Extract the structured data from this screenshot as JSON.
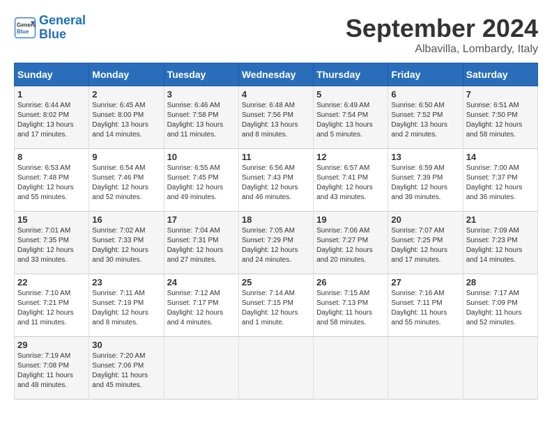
{
  "header": {
    "logo_line1": "General",
    "logo_line2": "Blue",
    "month_year": "September 2024",
    "location": "Albavilla, Lombardy, Italy"
  },
  "columns": [
    "Sunday",
    "Monday",
    "Tuesday",
    "Wednesday",
    "Thursday",
    "Friday",
    "Saturday"
  ],
  "weeks": [
    [
      {
        "day": "1",
        "info": "Sunrise: 6:44 AM\nSunset: 8:02 PM\nDaylight: 13 hours\nand 17 minutes."
      },
      {
        "day": "2",
        "info": "Sunrise: 6:45 AM\nSunset: 8:00 PM\nDaylight: 13 hours\nand 14 minutes."
      },
      {
        "day": "3",
        "info": "Sunrise: 6:46 AM\nSunset: 7:58 PM\nDaylight: 13 hours\nand 11 minutes."
      },
      {
        "day": "4",
        "info": "Sunrise: 6:48 AM\nSunset: 7:56 PM\nDaylight: 13 hours\nand 8 minutes."
      },
      {
        "day": "5",
        "info": "Sunrise: 6:49 AM\nSunset: 7:54 PM\nDaylight: 13 hours\nand 5 minutes."
      },
      {
        "day": "6",
        "info": "Sunrise: 6:50 AM\nSunset: 7:52 PM\nDaylight: 13 hours\nand 2 minutes."
      },
      {
        "day": "7",
        "info": "Sunrise: 6:51 AM\nSunset: 7:50 PM\nDaylight: 12 hours\nand 58 minutes."
      }
    ],
    [
      {
        "day": "8",
        "info": "Sunrise: 6:53 AM\nSunset: 7:48 PM\nDaylight: 12 hours\nand 55 minutes."
      },
      {
        "day": "9",
        "info": "Sunrise: 6:54 AM\nSunset: 7:46 PM\nDaylight: 12 hours\nand 52 minutes."
      },
      {
        "day": "10",
        "info": "Sunrise: 6:55 AM\nSunset: 7:45 PM\nDaylight: 12 hours\nand 49 minutes."
      },
      {
        "day": "11",
        "info": "Sunrise: 6:56 AM\nSunset: 7:43 PM\nDaylight: 12 hours\nand 46 minutes."
      },
      {
        "day": "12",
        "info": "Sunrise: 6:57 AM\nSunset: 7:41 PM\nDaylight: 12 hours\nand 43 minutes."
      },
      {
        "day": "13",
        "info": "Sunrise: 6:59 AM\nSunset: 7:39 PM\nDaylight: 12 hours\nand 39 minutes."
      },
      {
        "day": "14",
        "info": "Sunrise: 7:00 AM\nSunset: 7:37 PM\nDaylight: 12 hours\nand 36 minutes."
      }
    ],
    [
      {
        "day": "15",
        "info": "Sunrise: 7:01 AM\nSunset: 7:35 PM\nDaylight: 12 hours\nand 33 minutes."
      },
      {
        "day": "16",
        "info": "Sunrise: 7:02 AM\nSunset: 7:33 PM\nDaylight: 12 hours\nand 30 minutes."
      },
      {
        "day": "17",
        "info": "Sunrise: 7:04 AM\nSunset: 7:31 PM\nDaylight: 12 hours\nand 27 minutes."
      },
      {
        "day": "18",
        "info": "Sunrise: 7:05 AM\nSunset: 7:29 PM\nDaylight: 12 hours\nand 24 minutes."
      },
      {
        "day": "19",
        "info": "Sunrise: 7:06 AM\nSunset: 7:27 PM\nDaylight: 12 hours\nand 20 minutes."
      },
      {
        "day": "20",
        "info": "Sunrise: 7:07 AM\nSunset: 7:25 PM\nDaylight: 12 hours\nand 17 minutes."
      },
      {
        "day": "21",
        "info": "Sunrise: 7:09 AM\nSunset: 7:23 PM\nDaylight: 12 hours\nand 14 minutes."
      }
    ],
    [
      {
        "day": "22",
        "info": "Sunrise: 7:10 AM\nSunset: 7:21 PM\nDaylight: 12 hours\nand 11 minutes."
      },
      {
        "day": "23",
        "info": "Sunrise: 7:11 AM\nSunset: 7:19 PM\nDaylight: 12 hours\nand 8 minutes."
      },
      {
        "day": "24",
        "info": "Sunrise: 7:12 AM\nSunset: 7:17 PM\nDaylight: 12 hours\nand 4 minutes."
      },
      {
        "day": "25",
        "info": "Sunrise: 7:14 AM\nSunset: 7:15 PM\nDaylight: 12 hours\nand 1 minute."
      },
      {
        "day": "26",
        "info": "Sunrise: 7:15 AM\nSunset: 7:13 PM\nDaylight: 11 hours\nand 58 minutes."
      },
      {
        "day": "27",
        "info": "Sunrise: 7:16 AM\nSunset: 7:11 PM\nDaylight: 11 hours\nand 55 minutes."
      },
      {
        "day": "28",
        "info": "Sunrise: 7:17 AM\nSunset: 7:09 PM\nDaylight: 11 hours\nand 52 minutes."
      }
    ],
    [
      {
        "day": "29",
        "info": "Sunrise: 7:19 AM\nSunset: 7:08 PM\nDaylight: 11 hours\nand 48 minutes."
      },
      {
        "day": "30",
        "info": "Sunrise: 7:20 AM\nSunset: 7:06 PM\nDaylight: 11 hours\nand 45 minutes."
      },
      {
        "day": "",
        "info": ""
      },
      {
        "day": "",
        "info": ""
      },
      {
        "day": "",
        "info": ""
      },
      {
        "day": "",
        "info": ""
      },
      {
        "day": "",
        "info": ""
      }
    ]
  ]
}
